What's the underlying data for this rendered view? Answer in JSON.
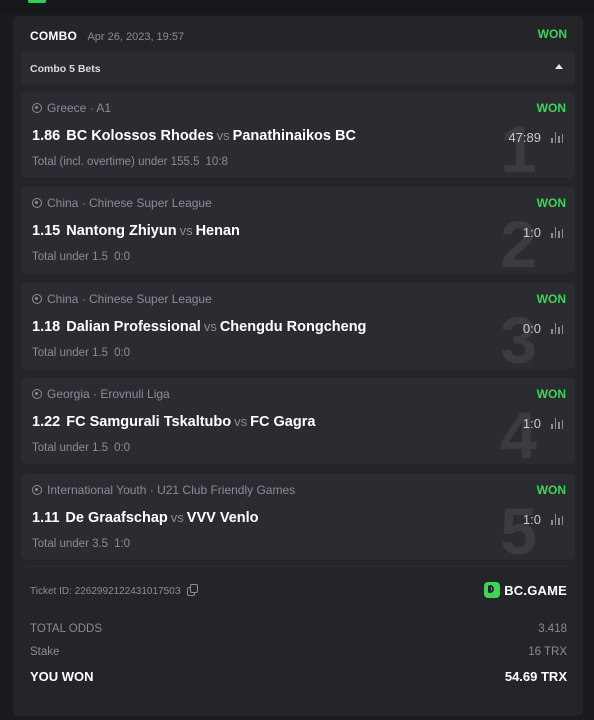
{
  "header": {
    "title": "COMBO",
    "date": "Apr 26, 2023, 19:57",
    "status": "WON"
  },
  "combo": {
    "label": "Combo 5 Bets",
    "expanded": true
  },
  "bets": [
    {
      "index": "1",
      "league": "Greece · A1",
      "status": "WON",
      "odds": "1.86",
      "home": "BC Kolossos Rhodes",
      "vs": "vs",
      "away": "Panathinaikos BC",
      "score": "47:89",
      "market": "Total (incl. overtime) under 155.5",
      "market_score": "10:8"
    },
    {
      "index": "2",
      "league": "China · Chinese Super League",
      "status": "WON",
      "odds": "1.15",
      "home": "Nantong Zhiyun",
      "vs": "vs",
      "away": "Henan",
      "score": "1:0",
      "market": "Total under 1.5",
      "market_score": "0:0"
    },
    {
      "index": "3",
      "league": "China · Chinese Super League",
      "status": "WON",
      "odds": "1.18",
      "home": "Dalian Professional",
      "vs": "vs",
      "away": "Chengdu Rongcheng",
      "score": "0:0",
      "market": "Total under 1.5",
      "market_score": "0:0"
    },
    {
      "index": "4",
      "league": "Georgia · Erovnuli Liga",
      "status": "WON",
      "odds": "1.22",
      "home": "FC Samgurali Tskaltubo",
      "vs": "vs",
      "away": "FC Gagra",
      "score": "1:0",
      "market": "Total under 1.5",
      "market_score": "0:0"
    },
    {
      "index": "5",
      "league": "International Youth · U21 Club Friendly Games",
      "status": "WON",
      "odds": "1.11",
      "home": "De Graafschap",
      "vs": "vs",
      "away": "VVV Venlo",
      "score": "1:0",
      "market": "Total under 3.5",
      "market_score": "1:0"
    }
  ],
  "ticket": {
    "label": "Ticket ID: 226299212243101750З",
    "brand": "BC.GAME"
  },
  "summary": {
    "total_odds_label": "TOTAL ODDS",
    "total_odds_value": "3.418",
    "stake_label": "Stake",
    "stake_value": "16 TRX",
    "won_label": "YOU WON",
    "won_value": "54.69 TRX"
  },
  "colors": {
    "accent": "#3fd35a",
    "background": "#1a1b1e",
    "card": "#232529",
    "bet_card": "#2a2c31"
  },
  "icons": [
    "ball-icon",
    "stats-icon",
    "copy-icon",
    "bcgame-logo-icon",
    "chevron-up-icon"
  ]
}
